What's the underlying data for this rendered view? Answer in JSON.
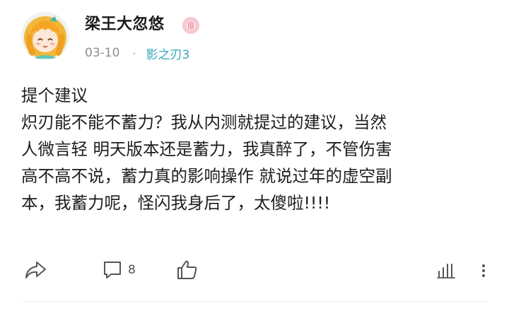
{
  "post": {
    "author": {
      "name": "梁王大忽悠",
      "avatar_icon": "anime-girl-avatar",
      "badge_icon": "pink-badge-icon"
    },
    "date": "03-10",
    "separator": "·",
    "topic": "影之刃3",
    "title": "提个建议",
    "body_lines": [
      "炽刃能不能不蓄力？我从内测就提过的建议，当然",
      "人微言轻 明天版本还是蓄力，我真醉了，不管伤害",
      "高不高不说，蓄力真的影响操作 就说过年的虚空副",
      "本，我蓄力呢，怪闪我身后了，太傻啦!!!!"
    ]
  },
  "actions": {
    "share_icon": "share-icon",
    "comment_icon": "comment-icon",
    "comment_count": "8",
    "like_icon": "thumbs-up-icon",
    "stats_icon": "bar-chart-icon",
    "more_icon": "more-vertical-icon"
  },
  "colors": {
    "accent_topic": "#34a6b8",
    "text": "#1e1e1e",
    "meta": "#8d8d8d",
    "badge": "#f7c8d2"
  }
}
